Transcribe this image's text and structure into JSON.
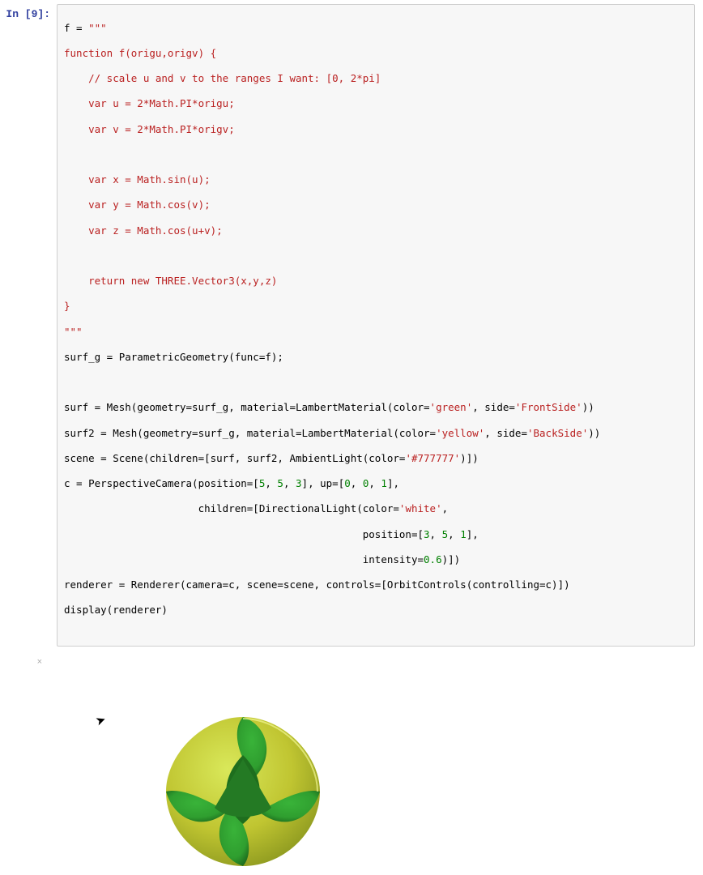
{
  "cell": {
    "prompt": "In [9]:",
    "code": {
      "l01a": "f = ",
      "l01b": "\"\"\"",
      "l02": "function f(origu,origv) {",
      "l03": "    // scale u and v to the ranges I want: [0, 2*pi]",
      "l04": "    var u = 2*Math.PI*origu;",
      "l05": "    var v = 2*Math.PI*origv;",
      "l06": "",
      "l07": "    var x = Math.sin(u);",
      "l08": "    var y = Math.cos(v);",
      "l09": "    var z = Math.cos(u+v);",
      "l10": "",
      "l11": "    return new THREE.Vector3(x,y,z)",
      "l12": "}",
      "l13": "\"\"\"",
      "l14": "surf_g = ParametricGeometry(func=f);",
      "l15": "",
      "l16a": "surf = Mesh(geometry=surf_g, material=LambertMaterial(color=",
      "l16b": "'green'",
      "l16c": ", side=",
      "l16d": "'FrontSide'",
      "l16e": "))",
      "l17a": "surf2 = Mesh(geometry=surf_g, material=LambertMaterial(color=",
      "l17b": "'yellow'",
      "l17c": ", side=",
      "l17d": "'BackSide'",
      "l17e": "))",
      "l18a": "scene = Scene(children=[surf, surf2, AmbientLight(color=",
      "l18b": "'#777777'",
      "l18c": ")])",
      "l19a": "c = PerspectiveCamera(position=[",
      "l19b": "5",
      "l19c": ", ",
      "l19d": "5",
      "l19e": ", ",
      "l19f": "3",
      "l19g": "], up=[",
      "l19h": "0",
      "l19i": ", ",
      "l19j": "0",
      "l19k": ", ",
      "l19l": "1",
      "l19m": "],",
      "l20a": "                      children=[DirectionalLight(color=",
      "l20b": "'white'",
      "l20c": ",",
      "l21a": "                                                 position=[",
      "l21b": "3",
      "l21c": ", ",
      "l21d": "5",
      "l21e": ", ",
      "l21f": "1",
      "l21g": "],",
      "l22a": "                                                 intensity=",
      "l22b": "0.6",
      "l22c": ")])",
      "l23": "renderer = Renderer(camera=c, scene=scene, controls=[OrbitControls(controlling=c)])",
      "l24": "display(renderer)"
    }
  },
  "output": {
    "close": "×",
    "colors": {
      "green": "#2F9E2F",
      "yellow": "#E8DA3D",
      "dark": "#1E6E1E"
    }
  }
}
